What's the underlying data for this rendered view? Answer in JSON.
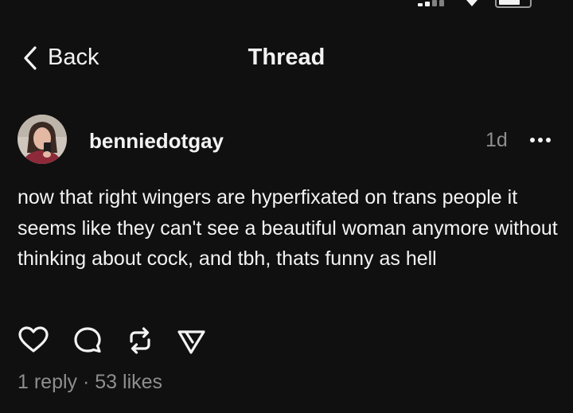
{
  "nav": {
    "back_label": "Back",
    "title": "Thread"
  },
  "post": {
    "username": "benniedotgay",
    "timestamp": "1d",
    "text": "now that right wingers are hyperfixated on trans people it seems like they can't see a beautiful woman anymore without thinking about cock, and tbh, thats funny as hell",
    "reply_count": "1 reply",
    "separator": "·",
    "like_count": "53 likes"
  },
  "actions": {
    "icons": [
      "heart-icon",
      "comment-icon",
      "repost-icon",
      "share-icon"
    ]
  },
  "colors": {
    "background": "#101010",
    "text": "#f3f3f3",
    "muted": "#8e8e8e"
  }
}
